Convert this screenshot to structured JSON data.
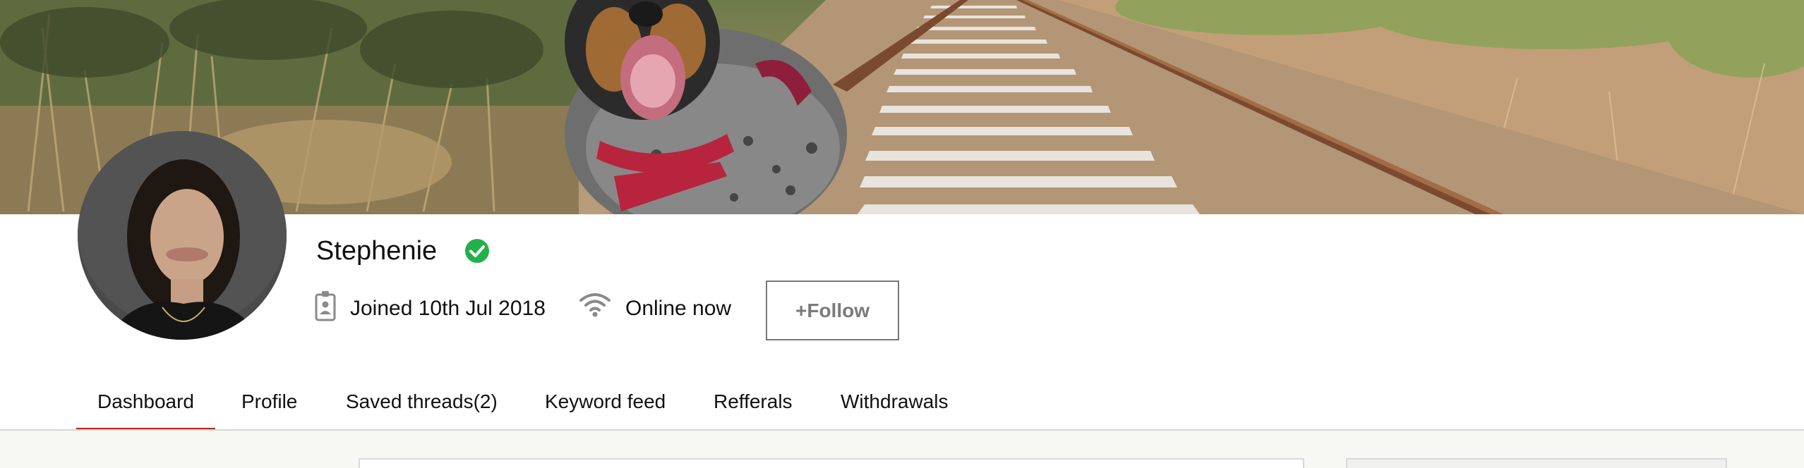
{
  "profile": {
    "name": "Stephenie",
    "joined": "Joined 10th Jul 2018",
    "status": "Online now",
    "follow_label": "+Follow",
    "verified_color": "#22b04b"
  },
  "icons": {
    "verified": "check-circle-icon",
    "badge": "id-badge-icon",
    "wifi": "wifi-icon"
  },
  "tabs": [
    {
      "label": "Dashboard",
      "active": true
    },
    {
      "label": "Profile"
    },
    {
      "label": "Saved threads(2)"
    },
    {
      "label": "Keyword feed"
    },
    {
      "label": "Refferals"
    },
    {
      "label": "Withdrawals"
    }
  ],
  "colors": {
    "active_tab_underline": "#b5251a",
    "follow_border": "#777777"
  }
}
